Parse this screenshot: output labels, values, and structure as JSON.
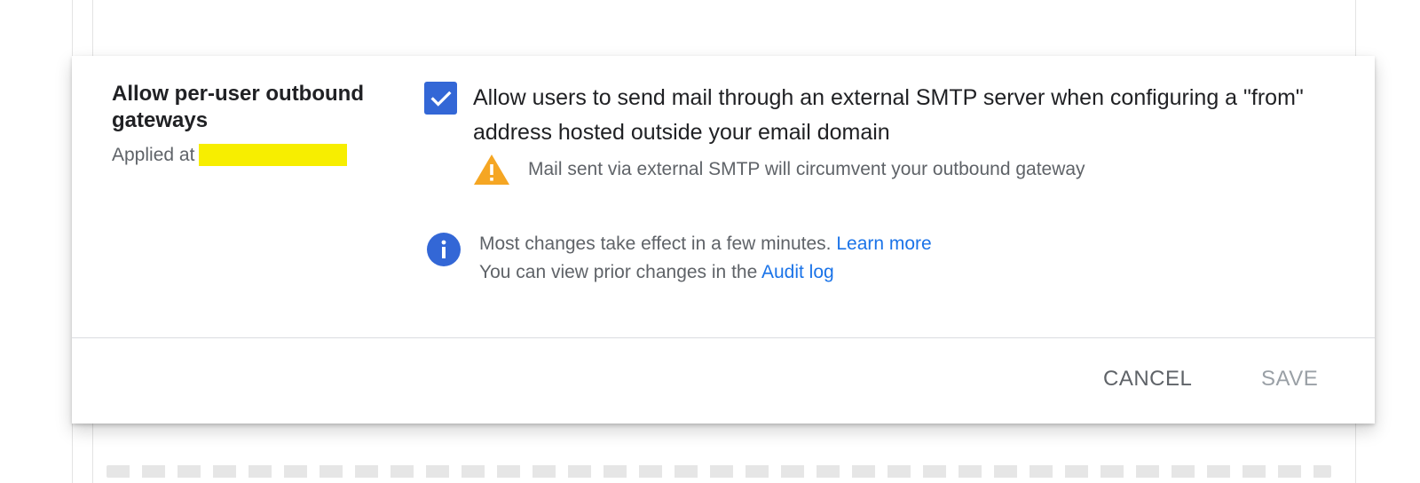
{
  "setting": {
    "title": "Allow per-user outbound gateways",
    "applied_prefix": "Applied at",
    "option_checked": true,
    "option_label": "Allow users to send mail through an external SMTP server when configuring a \"from\" address hosted outside your email domain",
    "warning_text": "Mail sent via external SMTP will circumvent your outbound gateway"
  },
  "info": {
    "line1_text": "Most changes take effect in a few minutes.",
    "learn_more_label": "Learn more",
    "line2_text": "You can view prior changes in the",
    "audit_log_label": "Audit log"
  },
  "actions": {
    "cancel_label": "CANCEL",
    "save_label": "SAVE"
  },
  "colors": {
    "accent": "#3367d6",
    "link": "#1a73e8",
    "warning": "#f5a623",
    "redaction": "#f7ee00"
  },
  "icons": {
    "checkbox": "check-icon",
    "warning": "warning-triangle-icon",
    "info": "info-icon"
  }
}
